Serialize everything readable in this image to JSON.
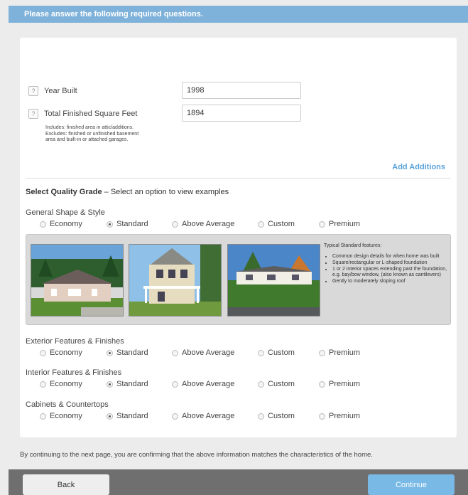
{
  "header": {
    "title": "Please answer the following required questions."
  },
  "questions": {
    "year_built": {
      "help": "?",
      "label": "Year Built",
      "value": "1998"
    },
    "square_feet": {
      "help": "?",
      "label": "Total Finished Square Feet",
      "value": "1894",
      "note_line1": "Includes: finished area in attic/additions.",
      "note_line2": "Excludes: finished or unfinished basement",
      "note_line3": "area and built-in or attached garages."
    }
  },
  "add_additions": "Add Additions",
  "quality": {
    "title": "Select Quality Grade",
    "subtitle": " – Select an option to view examples"
  },
  "options": [
    "Economy",
    "Standard",
    "Above Average",
    "Custom",
    "Premium"
  ],
  "sections": [
    {
      "label": "General Shape & Style",
      "selected": "Standard"
    },
    {
      "label": "Exterior Features & Finishes",
      "selected": "Standard"
    },
    {
      "label": "Interior Features & Finishes",
      "selected": "Standard"
    },
    {
      "label": "Cabinets & Countertops",
      "selected": "Standard"
    }
  ],
  "features": {
    "heading": "Typical Standard features:",
    "items": [
      "Common design details for when home was built",
      "Square/rectangular or L-shaped foundation",
      "1 or 2 interior spaces extending past the foundation, e.g. bay/bow window, (also known as cantilevers)",
      "Gently to moderately sloping roof"
    ]
  },
  "footer_note": "By continuing to the next page, you are confirming that the above information matches the characteristics of the home.",
  "buttons": {
    "back": "Back",
    "continue": "Continue"
  }
}
